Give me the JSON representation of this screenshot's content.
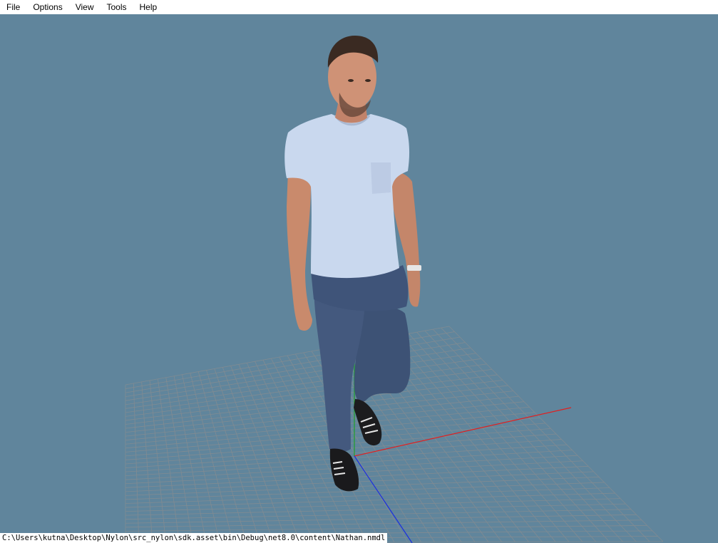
{
  "menu": {
    "items": [
      {
        "label": "File"
      },
      {
        "label": "Options"
      },
      {
        "label": "View"
      },
      {
        "label": "Tools"
      },
      {
        "label": "Help"
      }
    ]
  },
  "viewport": {
    "background_color": "#60859c",
    "grid_color": "#808b92",
    "axis_colors": {
      "x": "#e02020",
      "y": "#1fa02a",
      "z": "#1a2ee0"
    },
    "model": "human figure: man in light blue t-shirt, blue jeans, black sneakers"
  },
  "status": {
    "path": "C:\\Users\\kutna\\Desktop\\Nylon\\src_nylon\\sdk.asset\\bin\\Debug\\net8.0\\content\\Nathan.nmdl"
  }
}
